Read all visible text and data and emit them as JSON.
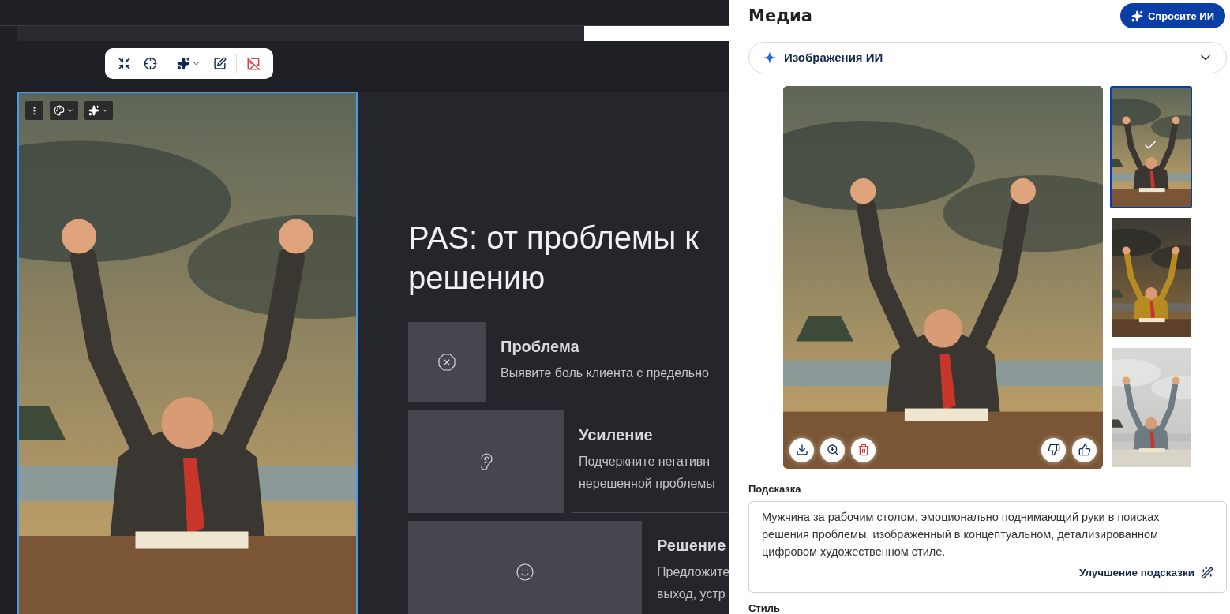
{
  "canvas": {
    "toolbar": {
      "red_toggle_on": true
    },
    "slide": {
      "title": "PAS: от проблемы к\nрешению",
      "cards": [
        {
          "title": "Проблема",
          "text": "Выявите боль клиента с предельно"
        },
        {
          "title": "Усиление",
          "text": "Подчеркните негативн\nнерешенной проблемы"
        },
        {
          "title": "Решение",
          "text": "Предложите\nвыход, устр"
        }
      ]
    }
  },
  "panel": {
    "title": "Медиа",
    "ask_button": "Спросите ИИ",
    "source_dropdown": {
      "label": "Изображения ИИ",
      "expanded": false
    },
    "thumbnails": [
      {
        "selected": true
      },
      {
        "selected": false
      },
      {
        "selected": false
      }
    ],
    "prompt": {
      "label": "Подсказка",
      "value": "Мужчина за рабочим столом, эмоционально поднимающий руки в поисках решения проблемы, изображенный в концептуальном, детализированном цифровом художественном стиле.",
      "improve_link": "Улучшение подсказки"
    },
    "style_label": "Стиль"
  }
}
